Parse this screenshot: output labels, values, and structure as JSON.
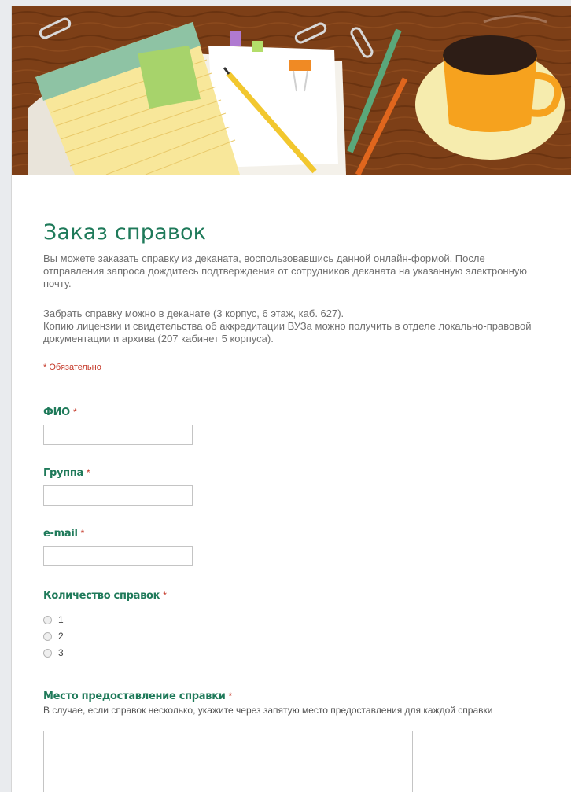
{
  "form": {
    "title": "Заказ справок",
    "description_1": "Вы можете заказать справку из деканата, воспользовавшись данной онлайн-формой. После отправления запроса дождитесь подтверждения от сотрудников деканата на указанную электронную почту.",
    "description_2": "Забрать справку можно в деканате (3 корпус, 6 этаж, каб. 627).",
    "description_3": "Копию лицензии и свидетельства об аккредитации ВУЗа можно получить в отделе локально-правовой документации и архива (207 кабинет 5 корпуса).",
    "required_note": "* Обязательно",
    "required_star": "*",
    "colors": {
      "accent": "#1f7a5a",
      "required": "#c53929",
      "header_wood": "#7a3d16"
    }
  },
  "questions": {
    "fio": {
      "label": "ФИО",
      "value": ""
    },
    "group": {
      "label": "Группа",
      "value": ""
    },
    "email": {
      "label": "e-mail",
      "value": ""
    },
    "count": {
      "label": "Количество справок",
      "options": [
        "1",
        "2",
        "3"
      ]
    },
    "place": {
      "label": "Место предоставление справки",
      "help": "В случае, если справок несколько, укажите через запятую место предоставления для каждой справки",
      "value": ""
    }
  },
  "header_icons": [
    "notepad-icon",
    "sticky-note-icon",
    "pencil-icon",
    "paperclip-icon",
    "binder-clip-icon",
    "pen-icon",
    "coffee-cup-icon"
  ]
}
